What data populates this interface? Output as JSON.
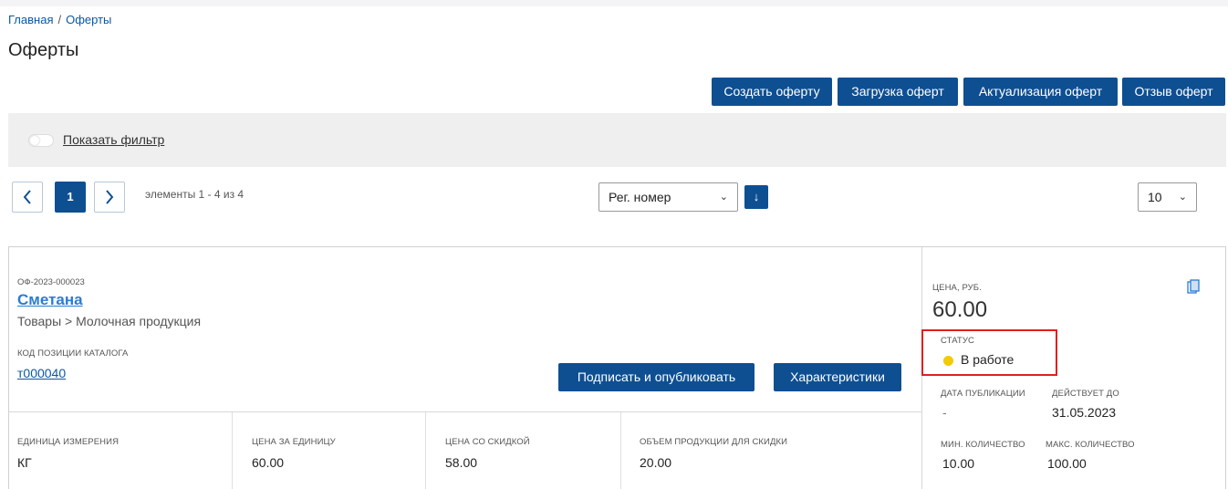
{
  "breadcrumb": {
    "home": "Главная",
    "separator": "/",
    "current": "Оферты"
  },
  "page": {
    "title": "Оферты"
  },
  "actions": {
    "create": "Создать оферту",
    "upload": "Загрузка оферт",
    "update": "Актуализация оферт",
    "recall": "Отзыв оферт"
  },
  "filter": {
    "toggle_label": "Показать фильтр",
    "enabled": false
  },
  "pagination": {
    "prev_icon": "chevron-left-icon",
    "next_icon": "chevron-right-icon",
    "current_page": "1",
    "info": "элементы 1 - 4 из 4",
    "sort_field": "Рег. номер",
    "sort_direction_icon": "↓",
    "page_size": "10"
  },
  "offer": {
    "reg_number": "ОФ-2023-000023",
    "name": "Сметана",
    "category": "Товары > Молочная продукция",
    "catalog_code_label": "КОД ПОЗИЦИИ КАТАЛОГА",
    "catalog_code": "т000040",
    "sign_button": "Подписать и опубликовать",
    "specs_button": "Характеристики",
    "unit_label": "ЕДИНИЦА ИЗМЕРЕНИЯ",
    "unit": "КГ",
    "unit_price_label": "ЦЕНА ЗА ЕДИНИЦУ",
    "unit_price": "60.00",
    "discount_price_label": "ЦЕНА СО СКИДКОЙ",
    "discount_price": "58.00",
    "discount_volume_label": "ОБЪЕМ ПРОДУКЦИИ ДЛЯ СКИДКИ",
    "discount_volume": "20.00",
    "price_label": "ЦЕНА, РУБ.",
    "price": "60.00",
    "status_label": "СТАТУС",
    "status": "В работе",
    "status_color": "#f2cb05",
    "pub_date_label": "ДАТА ПУБЛИКАЦИИ",
    "pub_date": "-",
    "valid_until_label": "ДЕЙСТВУЕТ ДО",
    "valid_until": "31.05.2023",
    "min_qty_label": "МИН. КОЛИЧЕСТВО",
    "min_qty": "10.00",
    "max_qty_label": "МАКС. КОЛИЧЕСТВО",
    "max_qty": "100.00",
    "copy_icon": "copy-icon"
  },
  "colors": {
    "primary": "#0e4f92",
    "link": "#2a7bd6",
    "highlight": "#e02020"
  }
}
